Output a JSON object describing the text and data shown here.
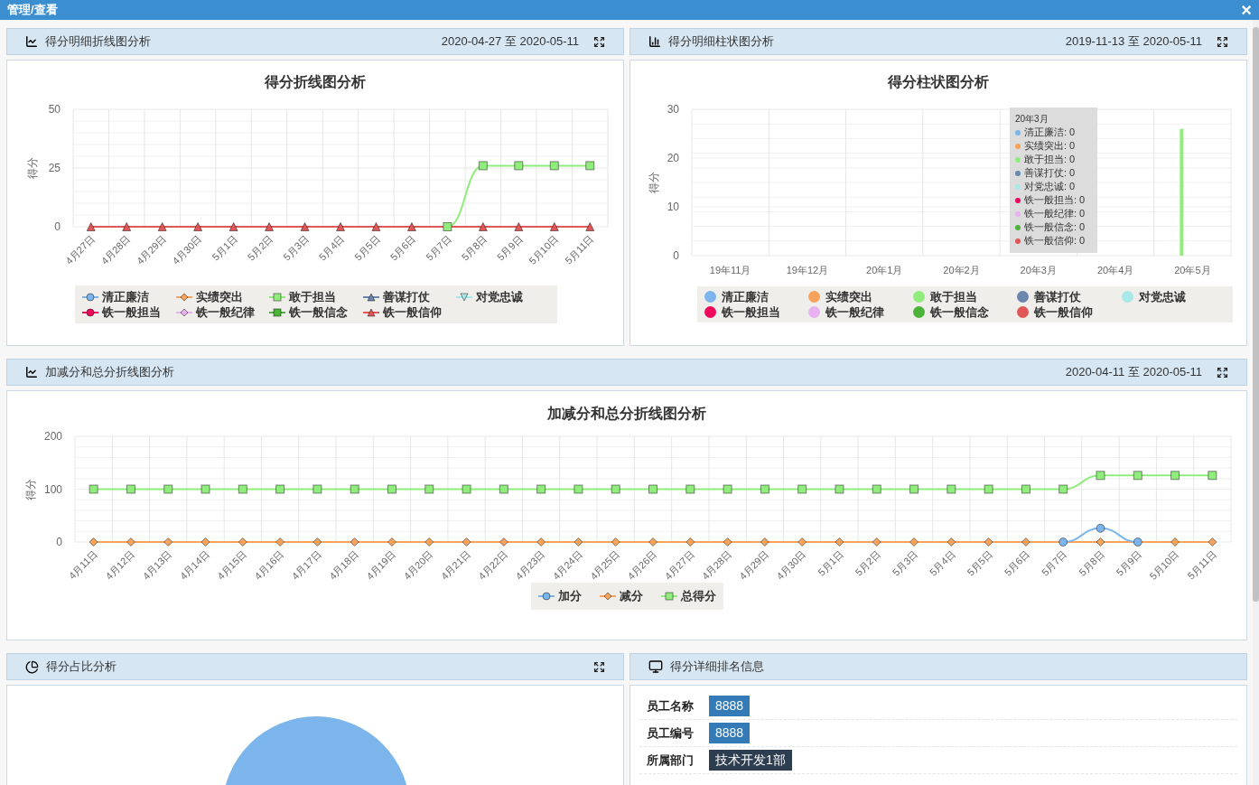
{
  "window": {
    "title": "管理/查看",
    "close": "×"
  },
  "score_line_panel": {
    "title": "得分明细折线图分析",
    "date_range": "2020-04-27 至 2020-05-11",
    "chart_data": {
      "type": "line",
      "title": "得分折线图分析",
      "ylabel": "得分",
      "categories": [
        "4月27日",
        "4月28日",
        "4月29日",
        "4月30日",
        "5月1日",
        "5月2日",
        "5月3日",
        "5月4日",
        "5月5日",
        "5月6日",
        "5月7日",
        "5月8日",
        "5月9日",
        "5月10日",
        "5月11日"
      ],
      "ylim": [
        0,
        50
      ],
      "yticks": [
        0,
        25,
        50
      ],
      "series": [
        {
          "name": "清正廉洁",
          "color": "#7cb5ec",
          "marker": "circle",
          "values": [
            null,
            null,
            null,
            null,
            null,
            null,
            null,
            null,
            null,
            null,
            null,
            null,
            null,
            null,
            null
          ]
        },
        {
          "name": "实绩突出",
          "color": "#f7a35c",
          "marker": "diamond",
          "values": [
            null,
            null,
            null,
            null,
            null,
            null,
            null,
            null,
            null,
            null,
            null,
            null,
            null,
            null,
            null
          ]
        },
        {
          "name": "敢于担当",
          "color": "#90ed7d",
          "marker": "square",
          "values": [
            null,
            null,
            null,
            null,
            null,
            null,
            null,
            null,
            null,
            null,
            0,
            26,
            26,
            26,
            26
          ]
        },
        {
          "name": "善谋打仗",
          "color": "#6c87ad",
          "marker": "triangle",
          "values": [
            null,
            null,
            null,
            null,
            null,
            null,
            null,
            null,
            null,
            null,
            null,
            null,
            null,
            null,
            null
          ]
        },
        {
          "name": "对党忠诚",
          "color": "#a8e8e8",
          "marker": "triangle-down",
          "values": [
            null,
            null,
            null,
            null,
            null,
            null,
            null,
            null,
            null,
            null,
            null,
            null,
            null,
            null,
            null
          ]
        },
        {
          "name": "铁一般担当",
          "color": "#ee0a5c",
          "marker": "circle",
          "values": [
            null,
            null,
            null,
            null,
            null,
            null,
            null,
            null,
            null,
            null,
            null,
            null,
            null,
            null,
            null
          ]
        },
        {
          "name": "铁一般纪律",
          "color": "#e8b1f0",
          "marker": "diamond",
          "values": [
            null,
            null,
            null,
            null,
            null,
            null,
            null,
            null,
            null,
            null,
            null,
            null,
            null,
            null,
            null
          ]
        },
        {
          "name": "铁一般信念",
          "color": "#4cb33a",
          "marker": "square",
          "values": [
            null,
            null,
            null,
            null,
            null,
            null,
            null,
            null,
            null,
            null,
            null,
            null,
            null,
            null,
            null
          ]
        },
        {
          "name": "铁一般信仰",
          "color": "#e05757",
          "marker": "triangle",
          "values": [
            0,
            0,
            0,
            0,
            0,
            0,
            0,
            0,
            0,
            0,
            0,
            0,
            0,
            0,
            0
          ]
        }
      ]
    }
  },
  "score_bar_panel": {
    "title": "得分明细柱状图分析",
    "date_range": "2019-11-13 至 2020-05-11",
    "chart_data": {
      "type": "bar",
      "title": "得分柱状图分析",
      "ylabel": "得分",
      "categories": [
        "19年11月",
        "19年12月",
        "20年1月",
        "20年2月",
        "20年3月",
        "20年4月",
        "20年5月"
      ],
      "ylim": [
        0,
        30
      ],
      "yticks": [
        0,
        10,
        20,
        30
      ],
      "series": [
        {
          "name": "清正廉洁",
          "color": "#7cb5ec",
          "values": [
            0,
            0,
            0,
            0,
            0,
            0,
            0
          ]
        },
        {
          "name": "实绩突出",
          "color": "#f7a35c",
          "values": [
            0,
            0,
            0,
            0,
            0,
            0,
            0
          ]
        },
        {
          "name": "敢于担当",
          "color": "#90ed7d",
          "values": [
            0,
            0,
            0,
            0,
            0,
            0,
            26
          ]
        },
        {
          "name": "善谋打仗",
          "color": "#6c87ad",
          "values": [
            0,
            0,
            0,
            0,
            0,
            0,
            0
          ]
        },
        {
          "name": "对党忠诚",
          "color": "#a8e8e8",
          "values": [
            0,
            0,
            0,
            0,
            0,
            0,
            0
          ]
        },
        {
          "name": "铁一般担当",
          "color": "#ee0a5c",
          "values": [
            0,
            0,
            0,
            0,
            0,
            0,
            0
          ]
        },
        {
          "name": "铁一般纪律",
          "color": "#e8b1f0",
          "values": [
            0,
            0,
            0,
            0,
            0,
            0,
            0
          ]
        },
        {
          "name": "铁一般信念",
          "color": "#4cb33a",
          "values": [
            0,
            0,
            0,
            0,
            0,
            0,
            0
          ]
        },
        {
          "name": "铁一般信仰",
          "color": "#e05757",
          "values": [
            0,
            0,
            0,
            0,
            0,
            0,
            0
          ]
        }
      ]
    },
    "tooltip": {
      "title": "20年3月",
      "items": [
        {
          "text": "清正廉洁: 0",
          "color": "#7cb5ec"
        },
        {
          "text": "实绩突出: 0",
          "color": "#f7a35c"
        },
        {
          "text": "敢于担当: 0",
          "color": "#90ed7d"
        },
        {
          "text": "善谋打仗: 0",
          "color": "#6c87ad"
        },
        {
          "text": "对党忠诚: 0",
          "color": "#a8e8e8"
        },
        {
          "text": "铁一般担当: 0",
          "color": "#ee0a5c"
        },
        {
          "text": "铁一般纪律: 0",
          "color": "#e8b1f0"
        },
        {
          "text": "铁一般信念: 0",
          "color": "#4cb33a"
        },
        {
          "text": "铁一般信仰: 0",
          "color": "#e05757"
        }
      ]
    }
  },
  "total_line_panel": {
    "title": "加减分和总分折线图分析",
    "date_range": "2020-04-11 至 2020-05-11",
    "chart_data": {
      "type": "line",
      "title": "加减分和总分折线图分析",
      "ylabel": "得分",
      "categories": [
        "4月11日",
        "4月12日",
        "4月13日",
        "4月14日",
        "4月15日",
        "4月16日",
        "4月17日",
        "4月18日",
        "4月19日",
        "4月20日",
        "4月21日",
        "4月22日",
        "4月23日",
        "4月24日",
        "4月25日",
        "4月26日",
        "4月27日",
        "4月28日",
        "4月29日",
        "4月30日",
        "5月1日",
        "5月2日",
        "5月3日",
        "5月4日",
        "5月5日",
        "5月6日",
        "5月7日",
        "5月8日",
        "5月9日",
        "5月10日",
        "5月11日"
      ],
      "ylim": [
        0,
        200
      ],
      "yticks": [
        0,
        100,
        200
      ],
      "series": [
        {
          "name": "加分",
          "color": "#7cb5ec",
          "marker": "circle",
          "values": [
            null,
            null,
            null,
            null,
            null,
            null,
            null,
            null,
            null,
            null,
            null,
            null,
            null,
            null,
            null,
            null,
            null,
            null,
            null,
            null,
            null,
            null,
            null,
            null,
            null,
            null,
            0,
            26,
            0,
            null,
            null
          ]
        },
        {
          "name": "减分",
          "color": "#f7a35c",
          "marker": "diamond",
          "values": [
            0,
            0,
            0,
            0,
            0,
            0,
            0,
            0,
            0,
            0,
            0,
            0,
            0,
            0,
            0,
            0,
            0,
            0,
            0,
            0,
            0,
            0,
            0,
            0,
            0,
            0,
            0,
            0,
            0,
            0,
            0
          ]
        },
        {
          "name": "总得分",
          "color": "#90ed7d",
          "marker": "square",
          "values": [
            100,
            100,
            100,
            100,
            100,
            100,
            100,
            100,
            100,
            100,
            100,
            100,
            100,
            100,
            100,
            100,
            100,
            100,
            100,
            100,
            100,
            100,
            100,
            100,
            100,
            100,
            100,
            126,
            126,
            126,
            126
          ]
        }
      ]
    }
  },
  "pie_panel": {
    "title": "得分占比分析"
  },
  "rank_panel": {
    "title": "得分详细排名信息",
    "rows": [
      {
        "label": "员工名称",
        "value": "8888",
        "kind": "primary"
      },
      {
        "label": "员工编号",
        "value": "8888",
        "kind": "primary"
      },
      {
        "label": "所属部门",
        "value": "技术开发1部",
        "kind": "dark"
      }
    ]
  }
}
